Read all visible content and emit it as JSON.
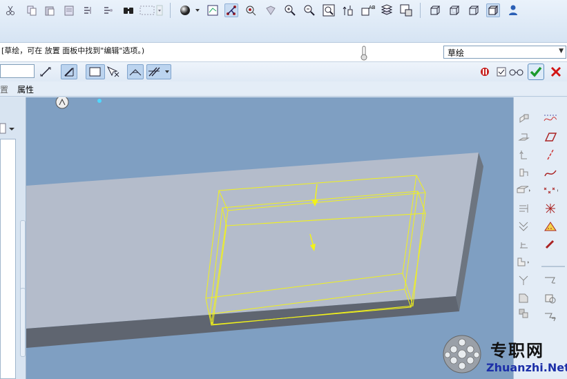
{
  "message": {
    "text": "[草绘，可在 放置 面板中找到\"编辑\"选项。)"
  },
  "sketch_select": {
    "value": "草绘"
  },
  "tabs": {
    "prefix": "置",
    "properties": "属性"
  },
  "value_input": {
    "value": ""
  },
  "watermark": {
    "cn": "专职网",
    "en": "Zhuanzhi.Net"
  },
  "icons": {
    "top_toolbar": [
      "cut-icon",
      "copy-icon",
      "paste-icon",
      "paste-special-icon",
      "regenerate-icon",
      "regen-manager-icon",
      "find-icon",
      "select-box-icon",
      "shading-icon",
      "refit-icon",
      "spin-center-icon",
      "saved-views-icon",
      "layer-icon",
      "zoom-in-icon",
      "zoom-out-icon",
      "zoom-fit-icon",
      "datum-axis-icon",
      "datum-point-icon",
      "csys-icon",
      "wireframe-icon",
      "hidden-line-icon",
      "no-hidden-icon",
      "shaded-icon",
      "model-tree-icon"
    ],
    "dashboard": [
      "depth-icon",
      "thicken-icon",
      "rectangle-icon",
      "flip-icon",
      "remove-material-icon",
      "pause-icon",
      "preview-icon",
      "ok-icon",
      "cancel-icon"
    ],
    "right_toolbar": [
      "datum-plane-icon",
      "datum-curve-icon",
      "extrude-icon",
      "sketch-icon",
      "revolve-icon",
      "datum-axis-icon",
      "sweep-icon",
      "spline-icon",
      "blend-icon",
      "point-icon",
      "hole-icon",
      "csys-icon",
      "rib-icon",
      "analysis-icon",
      "shell-icon",
      "chain-icon",
      "draft-icon",
      "group-icon",
      "round-icon",
      "pattern-icon",
      "chamfer-icon",
      "mirror-icon"
    ]
  },
  "colors": {
    "viewport_bg": "#7f9fc2",
    "plate_top": "#b4bccb",
    "plate_side": "#5f6570",
    "highlight": "#f2f21a",
    "ok_green": "#1a9a2c",
    "cancel_red": "#d11515",
    "watermark_en": "#1c2fa8"
  }
}
